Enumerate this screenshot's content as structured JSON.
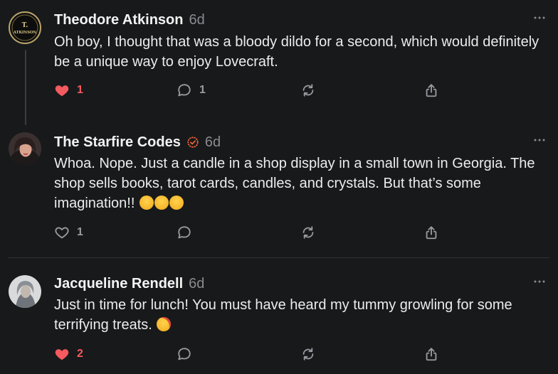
{
  "posts": [
    {
      "author": "Theodore Atkinson",
      "time": "6d",
      "avatar_text_top": "T.",
      "avatar_text_bottom": "ATKINSON",
      "text": "Oh boy, I thought that was a bloody dildo for a second, which would definitely be a unique way to enjoy Lovecraft.",
      "like_count": "1",
      "liked": true,
      "reply_count": "1"
    },
    {
      "author": "The Starfire Codes",
      "time": "6d",
      "verified": true,
      "text": "Whoa. Nope. Just a candle in a shop display in a small town in Georgia. The shop sells books, tarot cards, candles, and crystals. But that’s some imagination!!",
      "emojis": [
        "rofl-emoji",
        "rofl-emoji",
        "rofl-emoji"
      ],
      "like_count": "1",
      "liked": false,
      "reply_count": ""
    },
    {
      "author": "Jacqueline Rendell",
      "time": "6d",
      "text": "Just in time for lunch! You must have heard my tummy growling for some terrifying treats.",
      "emojis": [
        "face-blowing-kiss-emoji"
      ],
      "like_count": "2",
      "liked": true,
      "reply_count": ""
    }
  ],
  "colors": {
    "background": "#18191b",
    "like_red": "#f45a5e",
    "icon_gray": "#9a9ba0",
    "verified_orange": "#f0673a"
  }
}
